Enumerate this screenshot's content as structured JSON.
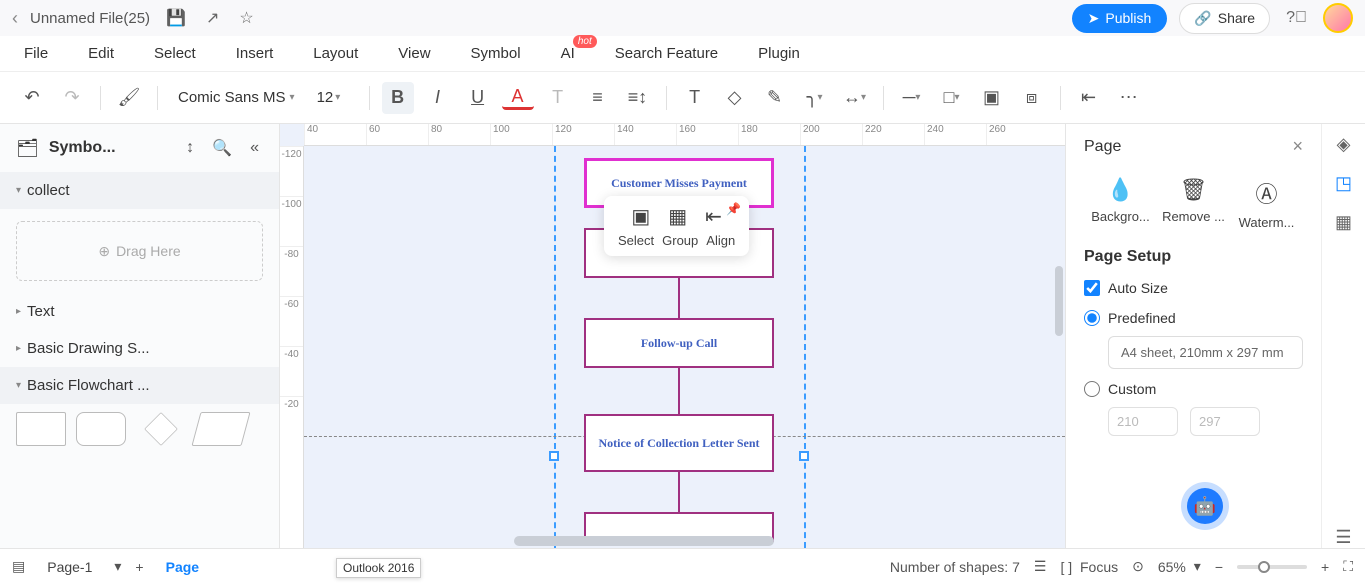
{
  "titlebar": {
    "filename": "Unnamed File(25)",
    "publish": "Publish",
    "share": "Share"
  },
  "menu": {
    "file": "File",
    "edit": "Edit",
    "select": "Select",
    "insert": "Insert",
    "layout": "Layout",
    "view": "View",
    "symbol": "Symbol",
    "ai": "AI",
    "ai_badge": "hot",
    "search": "Search Feature",
    "plugin": "Plugin"
  },
  "toolbar": {
    "font": "Comic Sans MS",
    "size": "12"
  },
  "sidebar": {
    "title": "Symbo...",
    "sections": {
      "collect": "collect",
      "text": "Text",
      "basic_drawing": "Basic Drawing S...",
      "basic_flowchart": "Basic Flowchart ..."
    },
    "drop": "Drag Here"
  },
  "ruler_h": [
    "40",
    "60",
    "80",
    "100",
    "120",
    "140",
    "160",
    "180",
    "200",
    "220",
    "240",
    "260"
  ],
  "ruler_v": [
    "-120",
    "-100",
    "-80",
    "-60",
    "-40",
    "-20"
  ],
  "flow": {
    "b1": "Customer Misses Payment",
    "b3": "Follow-up Call",
    "b4": "Notice of Collection Letter Sent"
  },
  "float": {
    "select": "Select",
    "group": "Group",
    "align": "Align"
  },
  "right": {
    "title": "Page",
    "tools": {
      "background": "Backgro...",
      "remove": "Remove ...",
      "watermark": "Waterm..."
    },
    "setup_title": "Page Setup",
    "auto_size": "Auto Size",
    "predefined": "Predefined",
    "preset": "A4 sheet, 210mm x 297 mm",
    "custom": "Custom",
    "w": "210",
    "h": "297"
  },
  "status": {
    "page1": "Page-1",
    "page_label": "Page",
    "tooltip": "Outlook 2016",
    "shapes": "Number of shapes: 7",
    "focus": "Focus",
    "zoom": "65%"
  }
}
